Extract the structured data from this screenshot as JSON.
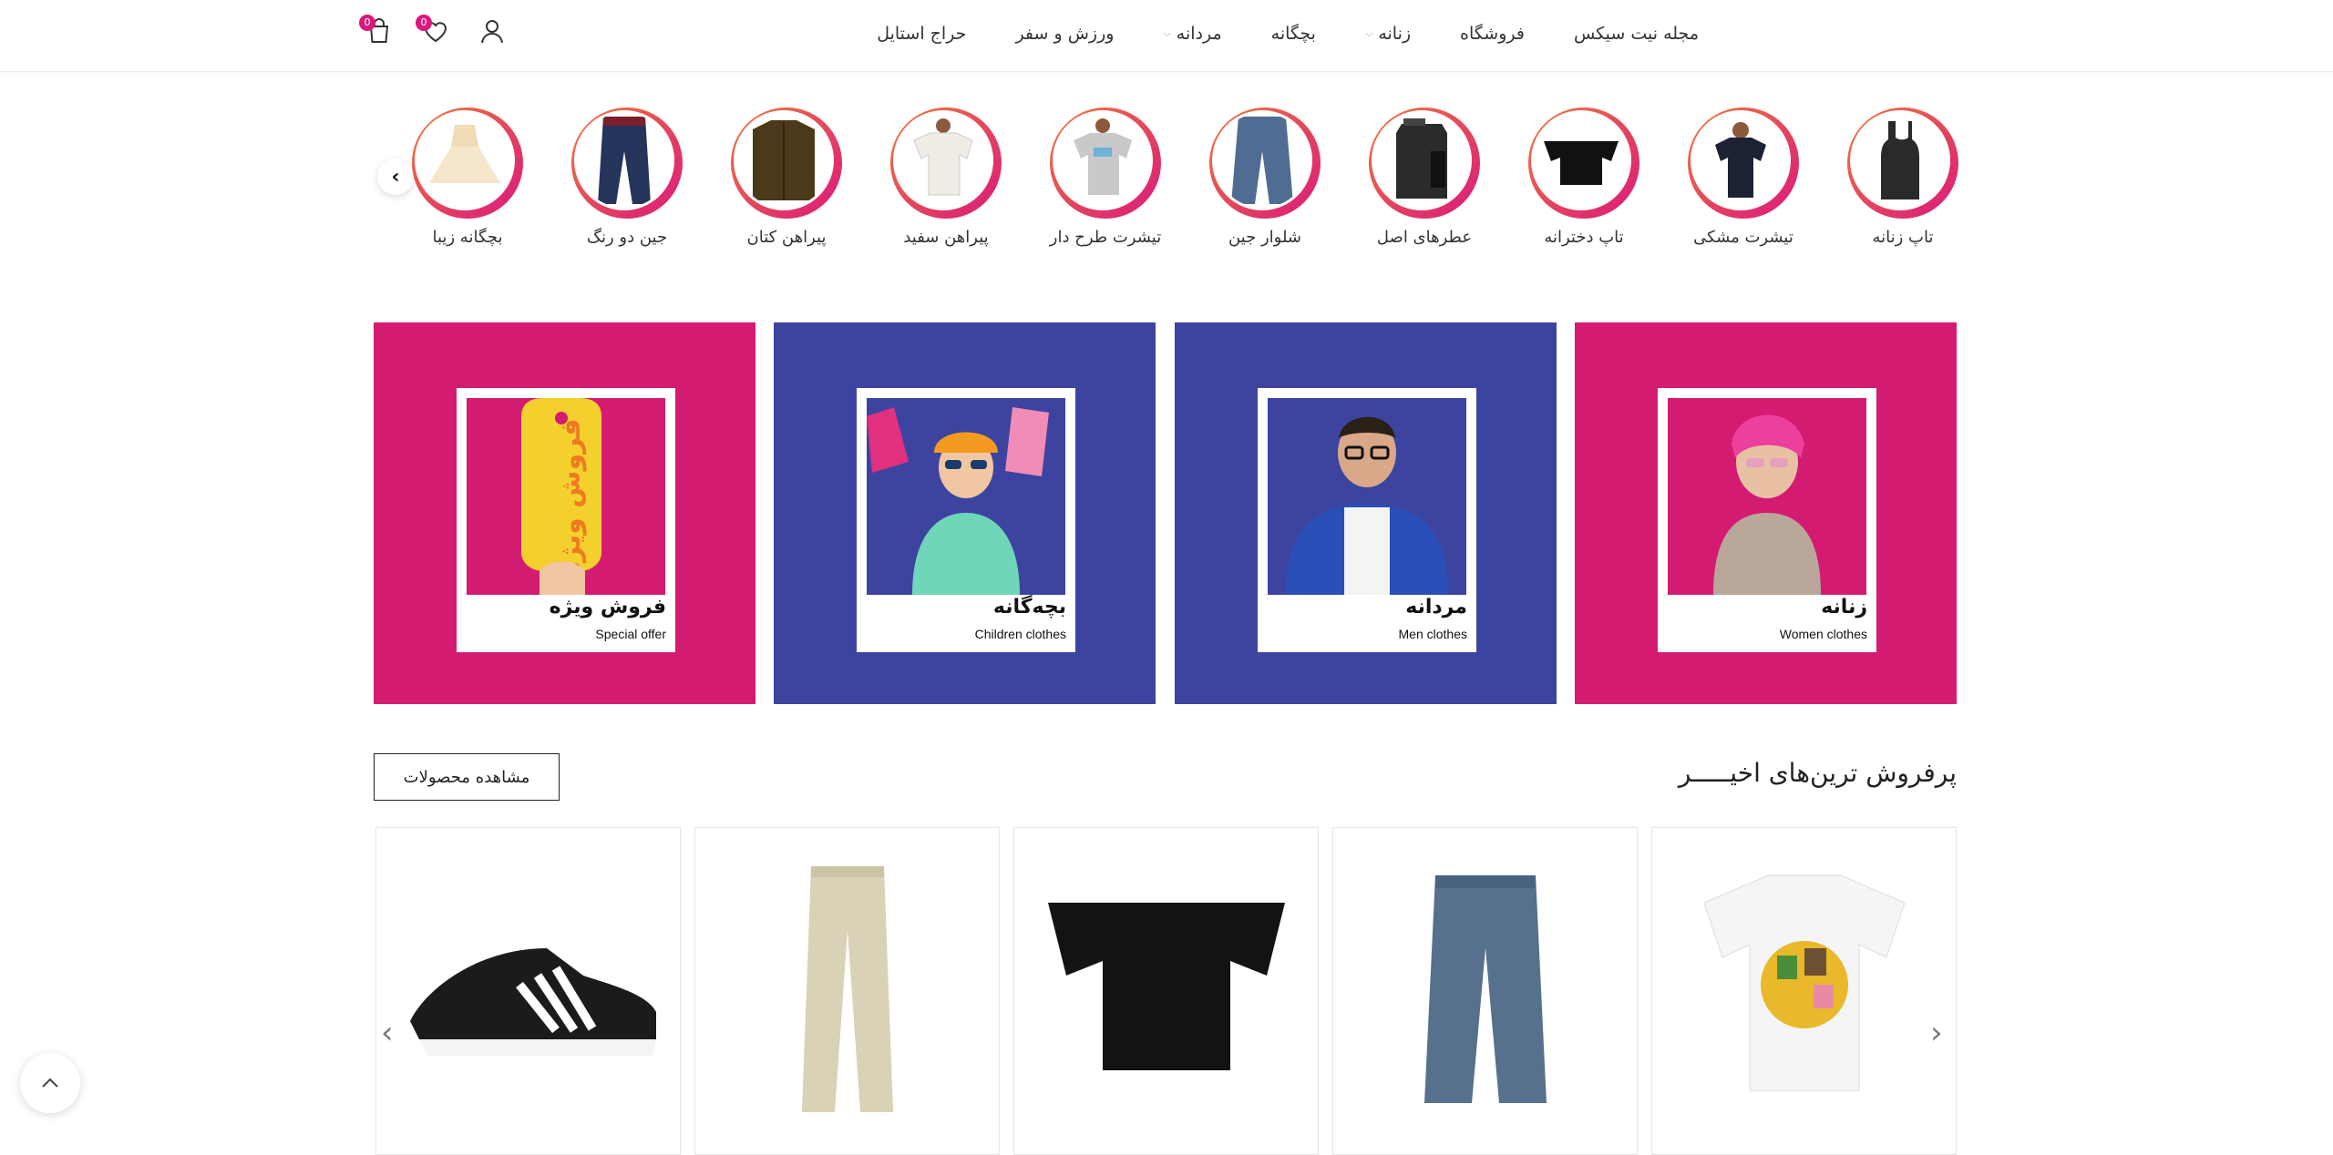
{
  "header": {
    "nav": [
      {
        "label": "حراج استایل",
        "dropdown": false
      },
      {
        "label": "ورزش و سفر",
        "dropdown": false
      },
      {
        "label": "مردانه",
        "dropdown": true
      },
      {
        "label": "بچگانه",
        "dropdown": false
      },
      {
        "label": "زنانه",
        "dropdown": true
      },
      {
        "label": "فروشگاه",
        "dropdown": false
      },
      {
        "label": "مجله نیت سیکس",
        "dropdown": false
      }
    ],
    "wishlist_count": "0",
    "cart_count": "0"
  },
  "stories": [
    {
      "label": "تاپ زنانه",
      "icon": "tank-top"
    },
    {
      "label": "تیشرت مشکی",
      "icon": "black-tshirt"
    },
    {
      "label": "تاپ دخترانه",
      "icon": "off-shoulder-top"
    },
    {
      "label": "عطرهای اصل",
      "icon": "perfume"
    },
    {
      "label": "شلوار جین",
      "icon": "jeans"
    },
    {
      "label": "تیشرت طرح دار",
      "icon": "printed-tshirt"
    },
    {
      "label": "پیراهن سفید",
      "icon": "white-shirt"
    },
    {
      "label": "پیراهن کتان",
      "icon": "linen-shirt"
    },
    {
      "label": "جین دو رنگ",
      "icon": "two-tone-jeans"
    },
    {
      "label": "بچگانه زیبا",
      "icon": "kids-dress"
    }
  ],
  "banners": [
    {
      "title": "زنانه",
      "subtitle": "Women clothes",
      "color": "#d41b72",
      "inner_color": "#d41b72"
    },
    {
      "title": "مردانه",
      "subtitle": "Men clothes",
      "color": "#3d44a0",
      "inner_color": "#3d44a0"
    },
    {
      "title": "بچه‌گانه",
      "subtitle": "Children clothes",
      "color": "#3d44a0",
      "inner_color": "#3d44a0"
    },
    {
      "title": "فروش ویژه",
      "subtitle": "Special offer",
      "color": "#d41b72",
      "inner_color": "#d41b72",
      "tag_text": "فروش ویژه"
    }
  ],
  "best_sellers": {
    "title": "پرفروش ترین‌های اخیـــــر",
    "view_button": "مشاهده محصولات"
  },
  "products": [
    {
      "icon": "white-tshirt-print"
    },
    {
      "icon": "blue-jeans"
    },
    {
      "icon": "black-top"
    },
    {
      "icon": "beige-pants"
    },
    {
      "icon": "black-sneaker"
    }
  ],
  "colors": {
    "accent": "#d9187d",
    "blue": "#3d44a0",
    "ring_start": "#f0793a",
    "ring_end": "#d9187d"
  }
}
